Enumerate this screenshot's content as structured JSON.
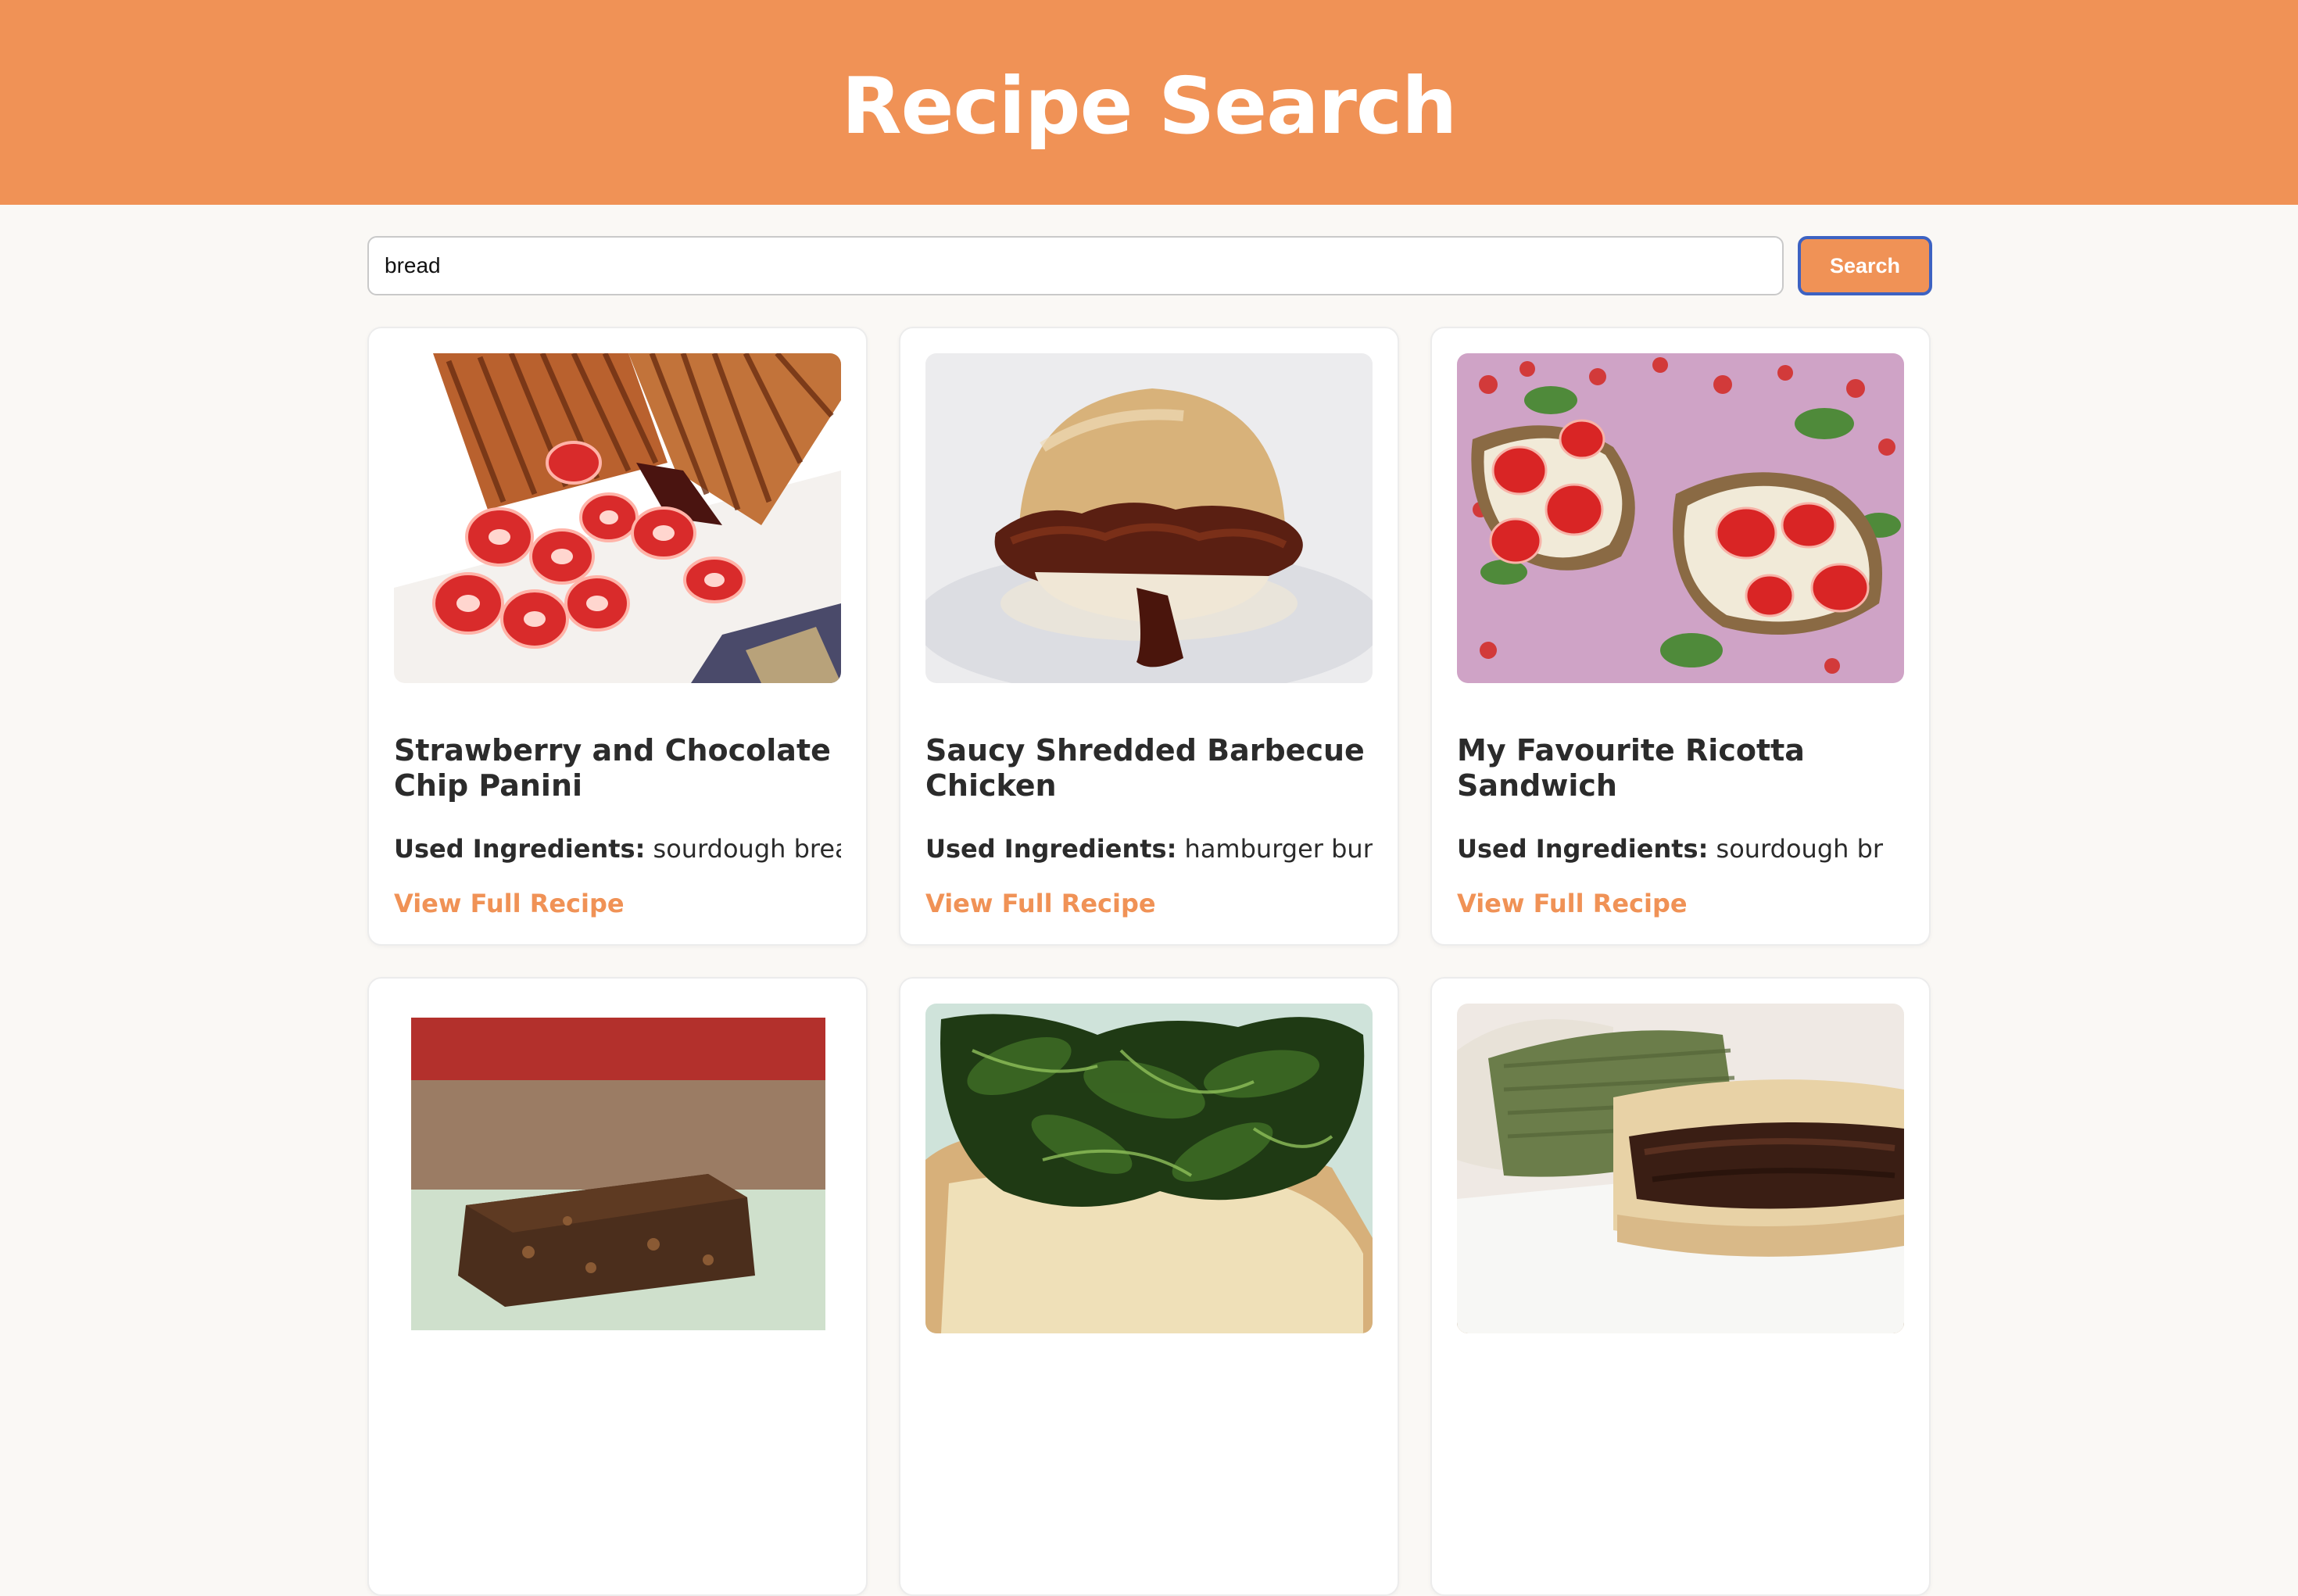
{
  "header": {
    "title": "Recipe Search"
  },
  "search": {
    "value": "bread",
    "button_label": "Search"
  },
  "colors": {
    "accent": "#f09256",
    "focus_border": "#3d62c2",
    "background": "#faf8f5"
  },
  "recipes": [
    {
      "title": "Strawberry and Chocolate Chip Panini",
      "used_label": "Used Ingredients:",
      "used_ingredients": "sourdough bread",
      "link_label": "View Full Recipe",
      "image": "panini-with-strawberries-photo"
    },
    {
      "title": "Saucy Shredded Barbecue Chicken",
      "used_label": "Used Ingredients:",
      "used_ingredients": "hamburger buns",
      "link_label": "View Full Recipe",
      "image": "barbecue-chicken-sandwich-photo"
    },
    {
      "title": "My Favourite Ricotta Sandwich",
      "used_label": "Used Ingredients:",
      "used_ingredients": "sourdough br",
      "link_label": "View Full Recipe",
      "image": "ricotta-strawberry-toast-photo"
    },
    {
      "title": "",
      "used_label": "",
      "used_ingredients": "",
      "link_label": "",
      "image": "brownie-slice-photo"
    },
    {
      "title": "",
      "used_label": "",
      "used_ingredients": "",
      "link_label": "",
      "image": "greens-on-toast-photo"
    },
    {
      "title": "",
      "used_label": "",
      "used_ingredients": "",
      "link_label": "",
      "image": "sausage-in-bun-photo"
    }
  ]
}
